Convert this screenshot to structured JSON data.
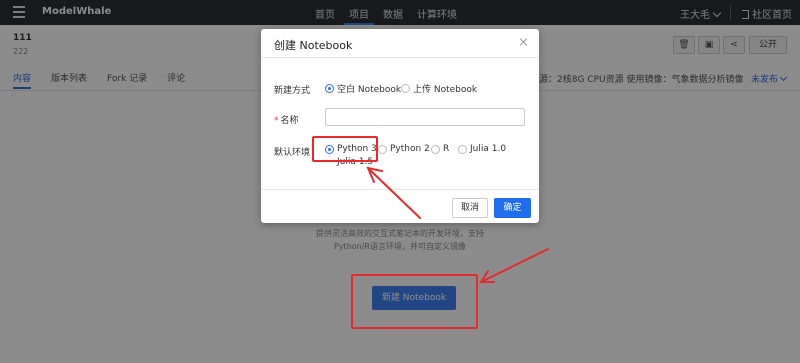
{
  "navbar": {
    "brand": "ModelWhale",
    "links": [
      "首页",
      "项目",
      "数据",
      "计算环境"
    ],
    "active_link": 1,
    "user": "王大毛",
    "community": "社区首页"
  },
  "project": {
    "title": "111",
    "id": "222",
    "public_label": "公开",
    "tabs": [
      "内容",
      "版本列表",
      "Fork 记录",
      "评论"
    ],
    "active_tab": 0,
    "resources": "资源：2核8G CPU资源   使用镜像：气象数据分析镜像",
    "env_select": "未发布"
  },
  "empty_state": {
    "description": "提供灵活高效的交互式笔记本的开发环境，支持Python/R语言环境，并可自定义镜像",
    "new_notebook_label": "新建 Notebook"
  },
  "modal": {
    "title": "创建 Notebook",
    "create_mode_label": "新建方式",
    "create_modes": [
      "空白 Notebook",
      "上传 Notebook"
    ],
    "create_mode_selected": 0,
    "name_label": "名称",
    "name_value": "",
    "env_label": "默认环境",
    "environments": [
      "Python 3",
      "Python 2",
      "R",
      "Julia 1.0",
      "Julia 1.5"
    ],
    "env_selected": 0,
    "cancel_label": "取消",
    "ok_label": "确定"
  },
  "annotation": {
    "color": "#e52b2b"
  }
}
